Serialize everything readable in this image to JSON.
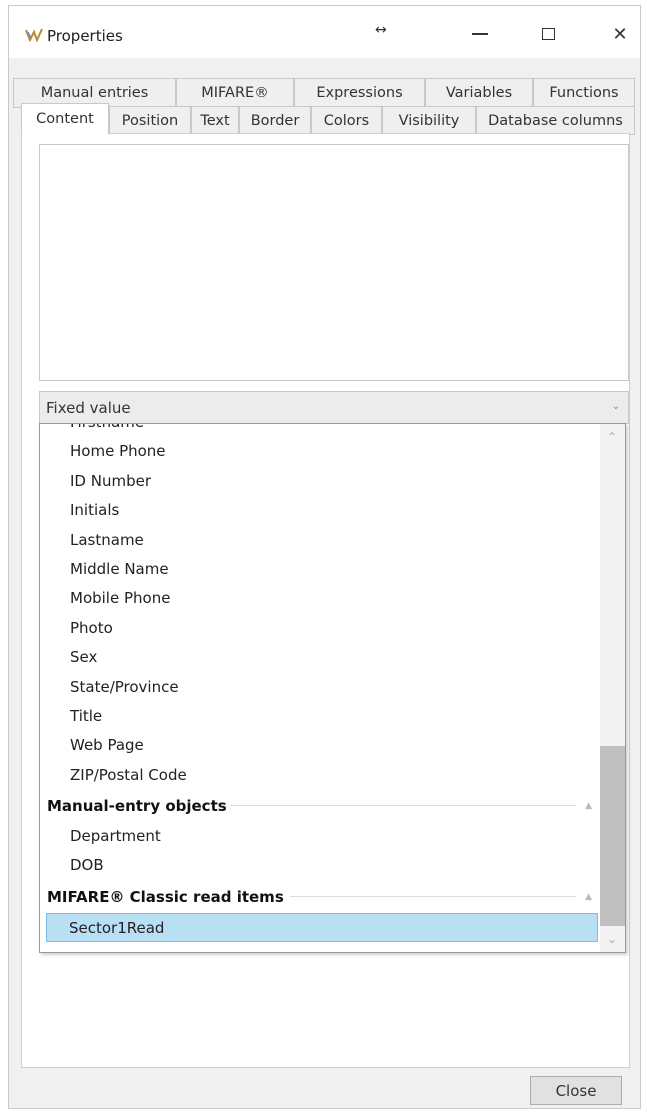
{
  "window": {
    "title": "Properties",
    "resize_glyph": "↔"
  },
  "title_buttons": {
    "close": "✕"
  },
  "tabs": {
    "row1": [
      "Manual entries",
      "MIFARE®",
      "Expressions",
      "Variables",
      "Functions"
    ],
    "row2": [
      "Content",
      "Position",
      "Text",
      "Border",
      "Colors",
      "Visibility",
      "Database columns"
    ],
    "selected": "Content"
  },
  "content": {
    "combo_value": "Fixed value",
    "combo_arrow": "⌄",
    "list": {
      "partial_top": "Firstname",
      "items": [
        "Home Phone",
        "ID Number",
        "Initials",
        "Lastname",
        "Middle Name",
        "Mobile Phone",
        "Photo",
        "Sex",
        "State/Province",
        "Title",
        "Web Page",
        "ZIP/Postal Code"
      ],
      "group_manual": {
        "label": "Manual-entry objects",
        "items": [
          "Department",
          "DOB"
        ]
      },
      "group_mifare": {
        "label": "MIFARE® Classic read items",
        "items": [
          "Sector1Read"
        ]
      },
      "group_caret": "▲",
      "selected_item": "Sector1Read"
    },
    "scroll_up": "⌃",
    "scroll_down": "⌄"
  },
  "footer": {
    "close_label": "Close"
  }
}
